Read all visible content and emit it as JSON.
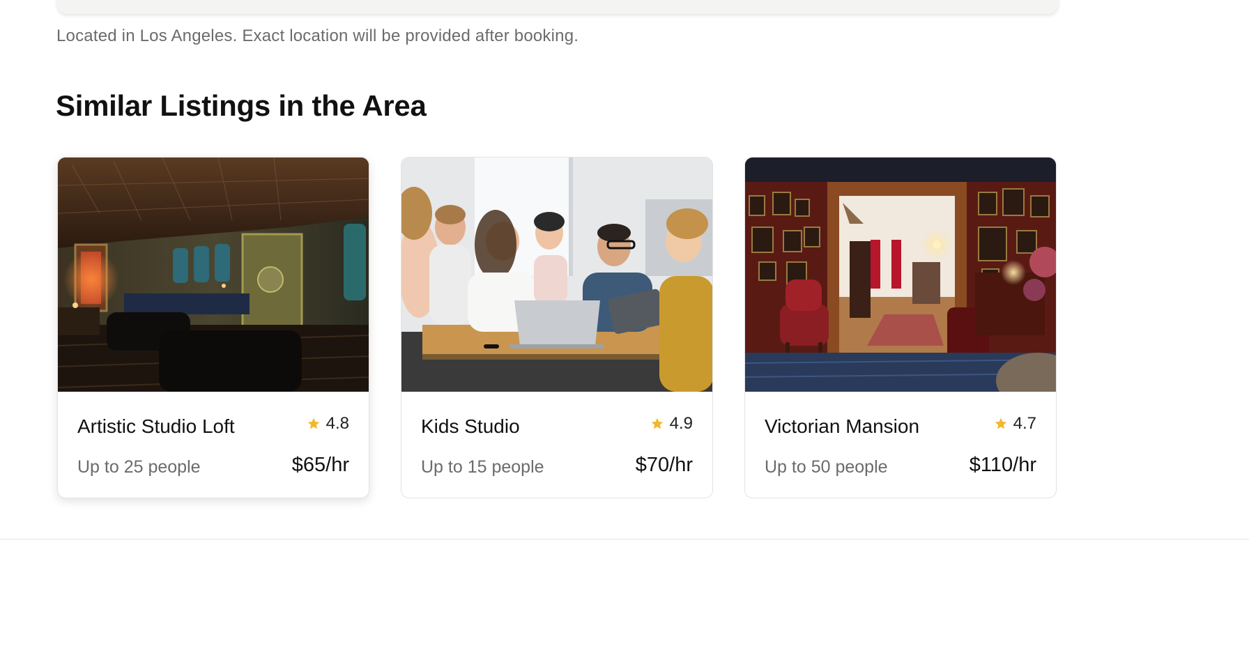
{
  "location_note": "Located in Los Angeles. Exact location will be provided after booking.",
  "similar": {
    "title": "Similar Listings in the Area",
    "listings": [
      {
        "name": "Artistic Studio Loft",
        "rating": "4.8",
        "capacity": "Up to 25 people",
        "price": "$65/hr",
        "photo": "dark-lounge-photo"
      },
      {
        "name": "Kids Studio",
        "rating": "4.9",
        "capacity": "Up to 15 people",
        "price": "$70/hr",
        "photo": "group-meeting-photo"
      },
      {
        "name": "Victorian Mansion",
        "rating": "4.7",
        "capacity": "Up to 50 people",
        "price": "$110/hr",
        "photo": "victorian-parlor-photo"
      }
    ]
  },
  "colors": {
    "star": "#f0b72f",
    "muted_text": "#6b6b6b",
    "border": "#e3e3e3"
  },
  "icons": {
    "rating": "star-icon"
  }
}
